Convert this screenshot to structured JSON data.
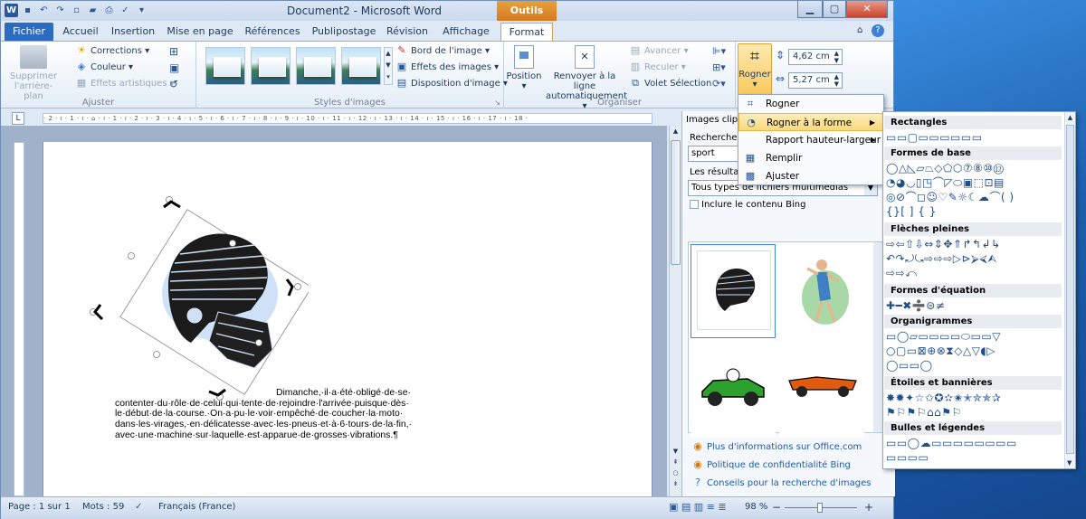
{
  "app": {
    "title": "Document2 - Microsoft Word",
    "context_tab": "Outils Image"
  },
  "tabs": [
    "Fichier",
    "Accueil",
    "Insertion",
    "Mise en page",
    "Références",
    "Publipostage",
    "Révision",
    "Affichage",
    "Format"
  ],
  "active_tab": "Format",
  "ribbon": {
    "ajuster": {
      "label": "Ajuster",
      "remove_bg": "Supprimer l'arrière-plan",
      "corrections": "Corrections ▾",
      "couleur": "Couleur ▾",
      "effets_artistiques": "Effets artistiques ▾"
    },
    "styles": {
      "label": "Styles d'images",
      "bord": "Bord de l'image ▾",
      "effets": "Effets des images ▾",
      "disposition": "Disposition d'image ▾"
    },
    "organiser": {
      "label": "Organiser",
      "position": "Position",
      "position_sub": "▾",
      "renvoyer": "Renvoyer à la ligne",
      "renvoyer_sub": "automatiquement ▾",
      "avancer": "Avancer ▾",
      "reculer": "Reculer ▾",
      "volet": "Volet Sélection"
    },
    "taille": {
      "rogner": "Rogner",
      "rogner_sub": "▾",
      "height": "4,62 cm",
      "width": "5,27 cm"
    }
  },
  "ruler_text": "· 2 · ı · 1 · ı · ⌂ · ı · 1 · ı · 2 · ı · 3 · ı · 4 · ı · 5 · ı · 6 · ı · 7 · ı · 8 · ı · 9 · ı · 10 · ı · 11 · ı · 12 · ı · 13 · ı · 14 · ı · 15 · ı · 16 · ı · 17 · ı · 18 ·",
  "document": {
    "line1": "Dimanche,·il·a·été·obligé·de·se·",
    "line2": "contenter·du·rôle·de·celui·qui·tente·de·rejoindre·l'arrivée·puisque·dès·",
    "line3": "le·début·de·la·course.·On·a·pu·le·voir·empêché·de·coucher·la·moto·",
    "line4": "dans·les·virages,·en·délicatesse·avec·les·pneus·et·à·6·tours·de·la·fin,·",
    "line5": "avec·une·machine·sur·laquelle·est·apparue·de·grosses·vibrations.¶"
  },
  "clipart_pane": {
    "title": "Images clipa",
    "search_label": "Rechercher :",
    "search_value": "sport",
    "results_label": "Les résultats",
    "media_types": "Tous types de fichiers multimédias",
    "bing_checkbox": "Inclure le contenu Bing",
    "links": [
      "Plus d'informations sur Office.com",
      "Politique de confidentialité Bing",
      "Conseils pour la recherche d'images"
    ]
  },
  "crop_menu": {
    "items": [
      "Rogner",
      "Rogner à la forme",
      "Rapport hauteur-largeur",
      "Remplir",
      "Ajuster"
    ],
    "highlighted": "Rogner à la forme"
  },
  "shapes_menu": {
    "sections": [
      {
        "title": "Rectangles",
        "rows": [
          "▭▭▢▭▭▭▭▭▭"
        ]
      },
      {
        "title": "Formes de base",
        "rows": [
          "◯△◺▱⏢◇⬠⬡⑦⑧⑩⑫",
          "◔◕◡▯◳⌒◸⬭▣⬚⊡▤",
          "◎⊘⌒◻☺♡✎☼☾☁⌒(  )",
          "{}[ ] { }"
        ]
      },
      {
        "title": "Flèches pleines",
        "rows": [
          "⇨⇦⇧⇩⇔⇕✥⇑↱↰↲↳",
          "↶↷⤾⤿⇨⇨⇨▷⊳⮚⮘⮙",
          "⇨⇨⤺"
        ]
      },
      {
        "title": "Formes d'équation",
        "rows": [
          "✚━✖➗⊜≠"
        ]
      },
      {
        "title": "Organigrammes",
        "rows": [
          "▭◯▱▭▭▭▭⬭▭▭▽",
          "○▢▭⊠⊕⊗⧗◇△▽◖▷",
          "◯▭▭◯"
        ]
      },
      {
        "title": "Étoiles et bannières",
        "rows": [
          "✸✹✦☆✩✪✫✬✭✮✯✰",
          "⚑⚐⚑⚐⌂⌂⚑⚐"
        ]
      },
      {
        "title": "Bulles et légendes",
        "rows": [
          "▭▭◯☁▭▭▭▭▭▭▭▭",
          "▭▭▭▭"
        ]
      }
    ]
  },
  "status": {
    "page": "Page : 1 sur 1",
    "words": "Mots : 59",
    "lang": "Français (France)",
    "zoom": "98 %",
    "minus": "−",
    "plus": "+"
  },
  "colors": {
    "file_tab": "#2b6cc0",
    "context_tab": "#e6a23c",
    "highlight": "#fbd97c"
  }
}
